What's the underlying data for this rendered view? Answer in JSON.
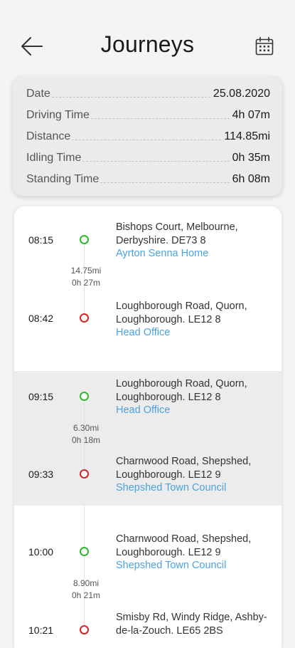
{
  "header": {
    "title": "Journeys",
    "back_icon": "arrow-left-icon",
    "calendar_icon": "calendar-icon"
  },
  "summary": {
    "rows": [
      {
        "label": "Date",
        "value": "25.08.2020"
      },
      {
        "label": "Driving Time",
        "value": "4h 07m"
      },
      {
        "label": "Distance",
        "value": "114.85mi"
      },
      {
        "label": "Idling Time",
        "value": "0h 35m"
      },
      {
        "label": "Standing Time",
        "value": "6h 08m"
      }
    ]
  },
  "colors": {
    "start_dot": "#2db82d",
    "end_dot": "#d9232a",
    "place_link": "#4aa3df"
  },
  "trips": [
    {
      "start_time": "08:15",
      "start_address": "Bishops Court, Melbourne, Derbyshire. DE73 8",
      "start_place": "Ayrton Senna  Home",
      "distance": "14.75mi",
      "duration": "0h 27m",
      "end_time": "08:42",
      "end_address": "Loughborough Road, Quorn, Loughborough. LE12 8",
      "end_place": "Head Office"
    },
    {
      "start_time": "09:15",
      "start_address": "Loughborough Road, Quorn, Loughborough. LE12 8",
      "start_place": "Head Office",
      "distance": "6.30mi",
      "duration": "0h 18m",
      "end_time": "09:33",
      "end_address": "Charnwood Road, Shepshed, Loughborough. LE12 9",
      "end_place": "Shepshed Town Council"
    },
    {
      "start_time": "10:00",
      "start_address": "Charnwood Road, Shepshed, Loughborough. LE12 9",
      "start_place": "Shepshed Town Council",
      "distance": "8.90mi",
      "duration": "0h 21m",
      "end_time": "10:21",
      "end_address": "Smisby Rd, Windy Ridge, Ashby-de-la-Zouch. LE65 2BS",
      "end_place": ""
    }
  ]
}
